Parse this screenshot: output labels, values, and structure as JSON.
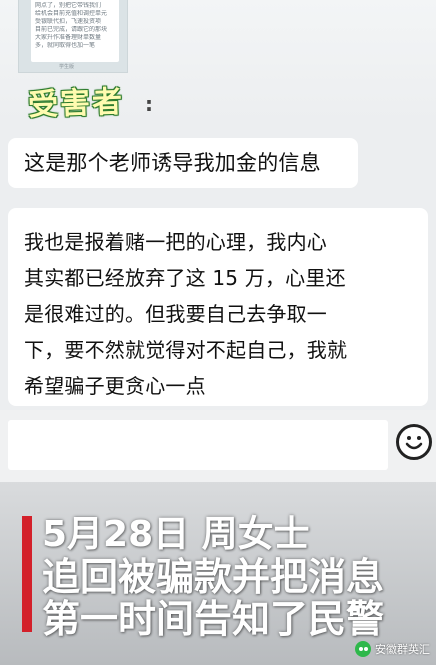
{
  "embedded_screenshot": {
    "lines": [
      "网点了，别把它带钱我们",
      "给机会目前充值和调控单元",
      "受银联代扣，飞速投资项",
      "目前已完成，请跟它的那块",
      "大家升作准备理财单数量",
      "多，就同取得也加一笔"
    ],
    "caption": "学生版"
  },
  "label": {
    "victim": "受害者",
    "colon": ":"
  },
  "messages": [
    {
      "lines": [
        "这是那个老师诱导我加金的信息"
      ]
    },
    {
      "lines": [
        "我也是报着赌一把的心理，我内心",
        "其实都已经放弃了这 15 万，心里还",
        "是很难过的。但我要自己去争取一",
        "下，要不然就觉得对不起自己，我就",
        "希望骗子更贪心一点"
      ]
    }
  ],
  "input_bar": {
    "value": "",
    "emoji_icon": "smiley-face-icon"
  },
  "news_caption": {
    "line1": "5月28日  周女士",
    "line2": "追回被骗款并把消息",
    "line3": "第一时间告知了民警",
    "accent_color": "#d3202a"
  },
  "watermark": {
    "text": "安徽群英汇"
  }
}
